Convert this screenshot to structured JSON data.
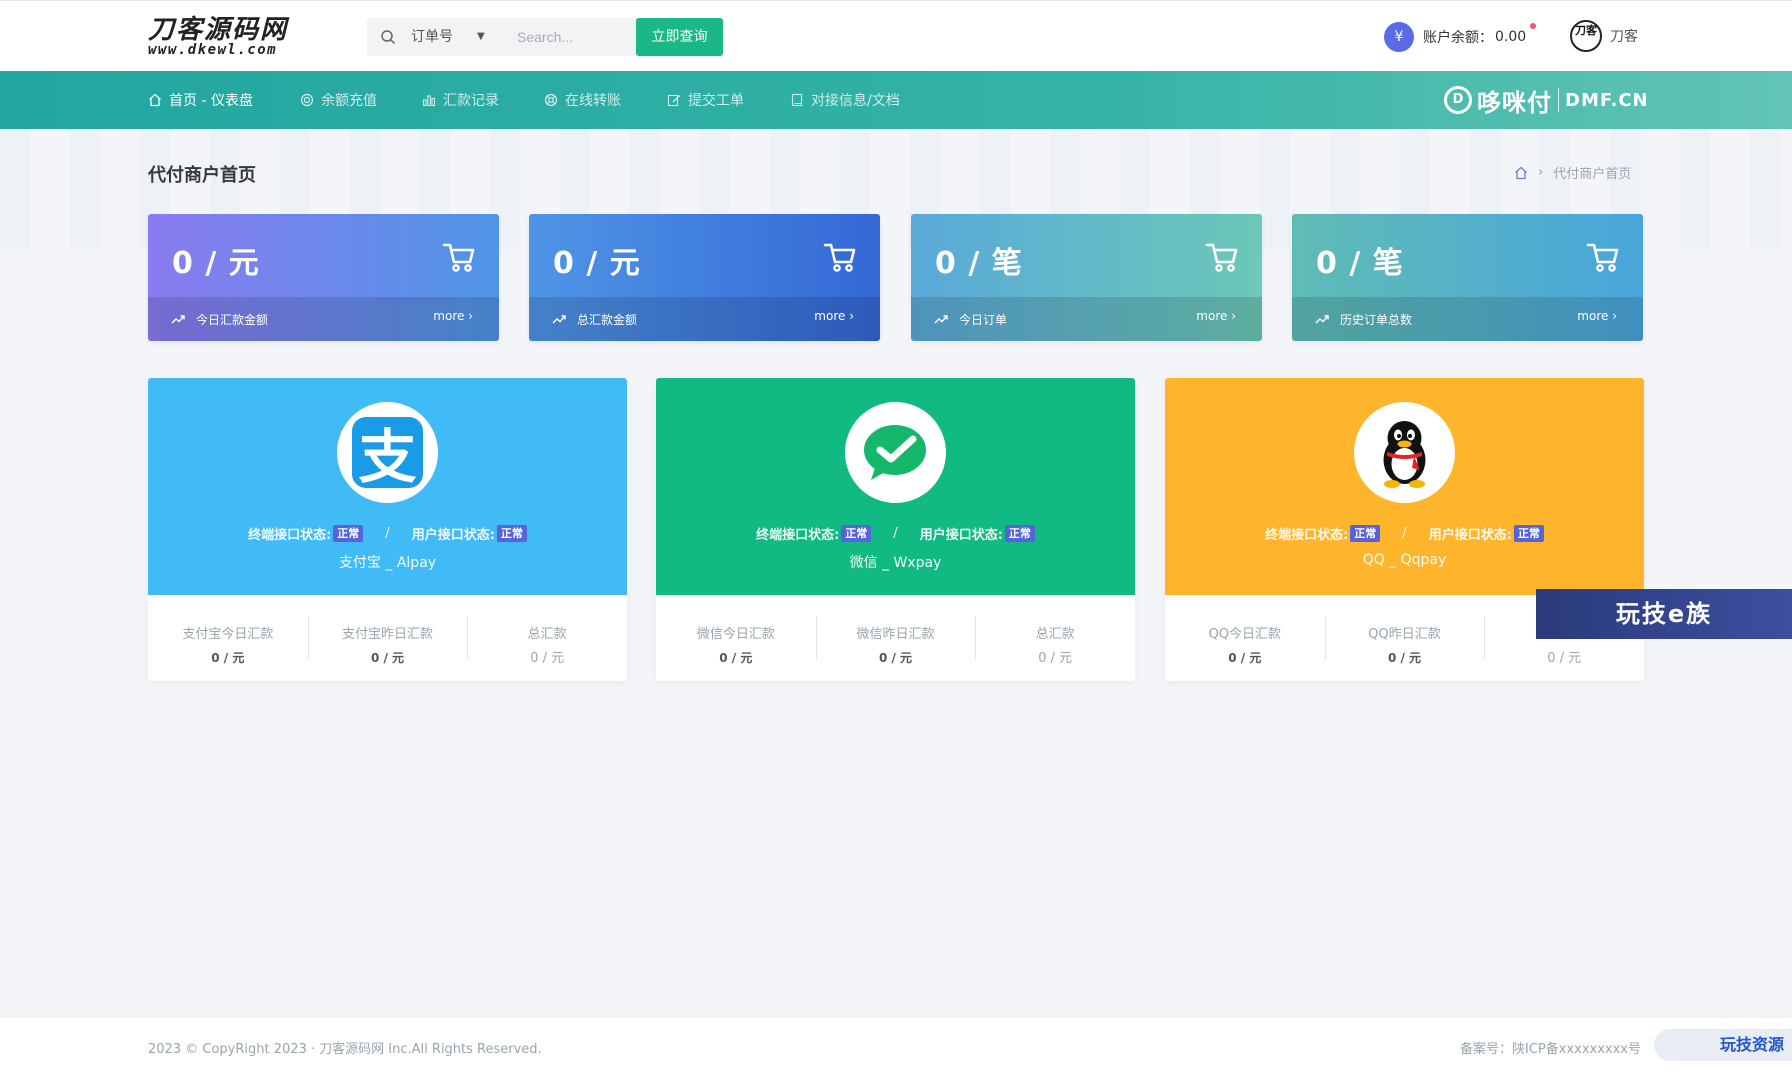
{
  "header": {
    "logo_line1": "刀客源码网",
    "logo_line2": "www.dkewl.com",
    "search": {
      "select_value": "订单号",
      "placeholder": "Search...",
      "button_label": "立即查询"
    },
    "balance_label": "账户余额：",
    "balance_value": "0.00",
    "user_name": "刀客",
    "avatar_text": "刀客"
  },
  "nav": {
    "items": [
      {
        "label": "首页 - 仪表盘",
        "icon": "home-icon"
      },
      {
        "label": "余额充值",
        "icon": "target-icon"
      },
      {
        "label": "汇款记录",
        "icon": "bar-chart-icon"
      },
      {
        "label": "在线转账",
        "icon": "life-ring-icon"
      },
      {
        "label": "提交工单",
        "icon": "edit-icon"
      },
      {
        "label": "对接信息/文档",
        "icon": "book-icon"
      }
    ],
    "brand_cn": "哆咪付",
    "brand_en": "DMF.CN"
  },
  "page": {
    "title": "代付商户首页",
    "breadcrumb": "代付商户首页",
    "breadcrumb_sep": "›"
  },
  "stat_cards": [
    {
      "value": "0 / 元",
      "label": "今日汇款金额",
      "more": "more ›",
      "color_from": "#8a7bf0",
      "color_to": "#4f95e6"
    },
    {
      "value": "0 / 元",
      "label": "总汇款金额",
      "more": "more ›",
      "color_from": "#4f95e6",
      "color_to": "#3468d6"
    },
    {
      "value": "0 / 笔",
      "label": "今日订单",
      "more": "more ›",
      "color_from": "#5aa9d9",
      "color_to": "#6cc8b8"
    },
    {
      "value": "0 / 笔",
      "label": "历史订单总数",
      "more": "more ›",
      "color_from": "#5fbcb5",
      "color_to": "#4aa5dc"
    }
  ],
  "pay_cards": [
    {
      "name": "支付宝 _ Alpay",
      "color": "#41bbf6",
      "logo_icon": "alipay-icon",
      "terminal_label": "终端接口状态:",
      "terminal_status": "正常",
      "separator": "/",
      "user_label": "用户接口状态:",
      "user_status": "正常",
      "stats": [
        {
          "label": "支付宝今日汇款",
          "value": "0 / 元"
        },
        {
          "label": "支付宝昨日汇款",
          "value": "0 / 元"
        },
        {
          "label": "总汇款",
          "value": "0 / 元"
        }
      ]
    },
    {
      "name": "微信 _ Wxpay",
      "color": "#11ba82",
      "logo_icon": "wechat-icon",
      "terminal_label": "终端接口状态:",
      "terminal_status": "正常",
      "separator": "/",
      "user_label": "用户接口状态:",
      "user_status": "正常",
      "stats": [
        {
          "label": "微信今日汇款",
          "value": "0 / 元"
        },
        {
          "label": "微信昨日汇款",
          "value": "0 / 元"
        },
        {
          "label": "总汇款",
          "value": "0 / 元"
        }
      ]
    },
    {
      "name": "QQ _ Qqpay",
      "color": "#feb52b",
      "logo_icon": "qq-penguin-icon",
      "terminal_label": "终端接口状态:",
      "terminal_status": "正常",
      "separator": "/",
      "user_label": "用户接口状态:",
      "user_status": "正常",
      "stats": [
        {
          "label": "QQ今日汇款",
          "value": "0 / 元"
        },
        {
          "label": "QQ昨日汇款",
          "value": "0 / 元"
        },
        {
          "label": "",
          "value": "0 / 元"
        }
      ]
    }
  ],
  "watermarks": {
    "badge": "玩技e族",
    "footer_badge": "玩技资源"
  },
  "footer": {
    "copyright": "2023 © CopyRight 2023 · 刀客源码网 Inc.All Rights Reserved.",
    "icp": "备案号：陕ICP备xxxxxxxxx号"
  }
}
